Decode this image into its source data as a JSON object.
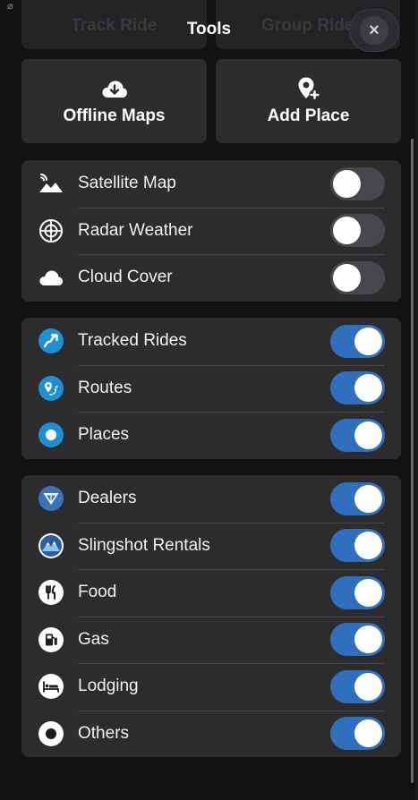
{
  "app": {
    "title": "Tools"
  },
  "background_cards": [
    "Track Ride",
    "Group Ride"
  ],
  "header": {
    "close_icon": "×"
  },
  "actions": [
    {
      "label": "Offline Maps",
      "icon": "cloud-download-icon"
    },
    {
      "label": "Add Place",
      "icon": "add-place-pin-icon"
    }
  ],
  "groups": [
    {
      "items": [
        {
          "label": "Satellite Map",
          "icon": "satellite-map-icon",
          "on": false
        },
        {
          "label": "Radar Weather",
          "icon": "radar-icon",
          "on": false
        },
        {
          "label": "Cloud Cover",
          "icon": "cloud-icon",
          "on": false
        }
      ]
    },
    {
      "items": [
        {
          "label": "Tracked Rides",
          "icon": "tracked-rides-icon",
          "on": true
        },
        {
          "label": "Routes",
          "icon": "routes-pin-icon",
          "on": true
        },
        {
          "label": "Places",
          "icon": "places-dot-icon",
          "on": true
        }
      ]
    },
    {
      "items": [
        {
          "label": "Dealers",
          "icon": "dealer-logo-icon",
          "on": true
        },
        {
          "label": "Slingshot Rentals",
          "icon": "mountain-rental-icon",
          "on": true
        },
        {
          "label": "Food",
          "icon": "fork-knife-icon",
          "on": true
        },
        {
          "label": "Gas",
          "icon": "gas-pump-icon",
          "on": true
        },
        {
          "label": "Lodging",
          "icon": "bed-icon",
          "on": true
        },
        {
          "label": "Others",
          "icon": "dot-circle-icon",
          "on": true
        }
      ]
    }
  ],
  "colors": {
    "accent": "#2f6fbd",
    "toggle_off": "#48484c",
    "card": "#2c2c2e",
    "background": "#121214"
  }
}
